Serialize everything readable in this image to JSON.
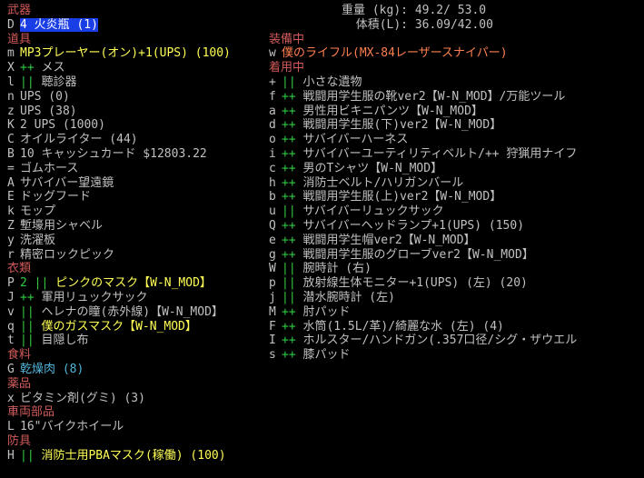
{
  "colors": {
    "category": "#d05a5a",
    "default": "#c0c0c0",
    "white": "#ffffff",
    "yellow": "#ffff55",
    "cyan": "#4fb4d8",
    "green": "#2ecc40",
    "orange": "#ff7f50",
    "highlight_bg": "#1a3ee6"
  },
  "stats": {
    "weight_label": "重量 (kg):",
    "weight_value": "49.2/ 53.0",
    "volume_label": "体積(L):",
    "volume_value": "36.09/42.00"
  },
  "left_rows": [
    {
      "type": "cat",
      "text": "武器"
    },
    {
      "key": "D",
      "mark": "",
      "mark_color": "",
      "text": "4 火炎瓶 (1)",
      "color": "white",
      "highlight": true,
      "tag": ""
    },
    {
      "type": "cat",
      "text": "道具"
    },
    {
      "key": "m",
      "mark": "",
      "mark_color": "",
      "text": "MP3プレーヤー(オン)+1(UPS) (100)",
      "color": "yellow",
      "tag": ""
    },
    {
      "key": "X",
      "mark": "++",
      "mark_color": "green",
      "text": "メス",
      "color": "default",
      "tag": ""
    },
    {
      "key": "l",
      "mark": "||",
      "mark_color": "green",
      "text": "聴診器",
      "color": "default",
      "tag": ""
    },
    {
      "key": "n",
      "mark": "",
      "mark_color": "",
      "text": "UPS (0)",
      "color": "default",
      "tag": ""
    },
    {
      "key": "z",
      "mark": "",
      "mark_color": "",
      "text": "UPS (38)",
      "color": "default",
      "tag": ""
    },
    {
      "key": "K",
      "mark": "",
      "mark_color": "",
      "text": "2 UPS (1000)",
      "color": "default",
      "tag": ""
    },
    {
      "key": "C",
      "mark": "",
      "mark_color": "",
      "text": "オイルライター (44)",
      "color": "default",
      "tag": ""
    },
    {
      "key": "B",
      "mark": "",
      "mark_color": "",
      "text": "10 キャッシュカード  $12803.22",
      "color": "default",
      "tag": ""
    },
    {
      "key": "=",
      "mark": "",
      "mark_color": "",
      "text": "ゴムホース",
      "color": "default",
      "tag": ""
    },
    {
      "key": "A",
      "mark": "",
      "mark_color": "",
      "text": "サバイバー望遠鏡",
      "color": "default",
      "tag": ""
    },
    {
      "key": "E",
      "mark": "",
      "mark_color": "",
      "text": "ドッグフード",
      "color": "default",
      "tag": ""
    },
    {
      "key": "k",
      "mark": "",
      "mark_color": "",
      "text": "モップ",
      "color": "default",
      "tag": ""
    },
    {
      "key": "Z",
      "mark": "",
      "mark_color": "",
      "text": "塹壕用シャベル",
      "color": "default",
      "tag": ""
    },
    {
      "key": "y",
      "mark": "",
      "mark_color": "",
      "text": "洗濯板",
      "color": "default",
      "tag": ""
    },
    {
      "key": "r",
      "mark": "",
      "mark_color": "",
      "text": "精密ロックピック",
      "color": "default",
      "tag": ""
    },
    {
      "type": "cat",
      "text": "衣類"
    },
    {
      "key": "P",
      "mark": "2 ||",
      "mark_color": "green",
      "text": "ピンクのマスク",
      "color": "yellow",
      "tag": "【W-N_MOD】",
      "tag_color": "yellow"
    },
    {
      "key": "J",
      "mark": "++",
      "mark_color": "green",
      "text": "軍用リュックサック",
      "color": "default",
      "tag": ""
    },
    {
      "key": "v",
      "mark": "||",
      "mark_color": "green",
      "text": "ヘレナの瞳(赤外線)",
      "color": "default",
      "tag": "【W-N_MOD】",
      "tag_color": "default"
    },
    {
      "key": "q",
      "mark": "||",
      "mark_color": "green",
      "text": "僕のガスマスク",
      "color": "yellow",
      "tag": "【W-N_MOD】",
      "tag_color": "yellow"
    },
    {
      "key": "t",
      "mark": "||",
      "mark_color": "green",
      "text": "目隠し布",
      "color": "default",
      "tag": ""
    },
    {
      "type": "cat",
      "text": "食料"
    },
    {
      "key": "G",
      "mark": "",
      "mark_color": "",
      "text": "乾燥肉 (8)",
      "color": "cyan",
      "tag": ""
    },
    {
      "type": "cat",
      "text": "薬品"
    },
    {
      "key": "x",
      "mark": "",
      "mark_color": "",
      "text": "ビタミン剤(グミ) (3)",
      "color": "default",
      "tag": ""
    },
    {
      "type": "cat",
      "text": "車両部品"
    },
    {
      "key": "L",
      "mark": "",
      "mark_color": "",
      "text": "16\"バイクホイール",
      "color": "default",
      "tag": ""
    },
    {
      "type": "cat",
      "text": "防具"
    },
    {
      "key": "H",
      "mark": "||",
      "mark_color": "green",
      "text": "消防士用PBAマスク(稼働) (100)",
      "color": "yellow",
      "tag": ""
    }
  ],
  "right_rows": [
    {
      "type": "cat",
      "text": "装備中"
    },
    {
      "key": "w",
      "mark": "",
      "mark_color": "",
      "text": "僕のライフル(MX-84レーザースナイパー)",
      "color": "orange",
      "tag": ""
    },
    {
      "type": "cat",
      "text": "着用中"
    },
    {
      "key": "+",
      "mark": "||",
      "mark_color": "green",
      "text": "小さな遺物",
      "color": "default",
      "tag": ""
    },
    {
      "key": "f",
      "mark": "++",
      "mark_color": "green",
      "text": "戦闘用学生服の靴ver2【W-N_MOD】/万能ツール",
      "color": "default",
      "tag": ""
    },
    {
      "key": "a",
      "mark": "++",
      "mark_color": "green",
      "text": "男性用ビキニパンツ【W-N_MOD】",
      "color": "default",
      "tag": ""
    },
    {
      "key": "d",
      "mark": "++",
      "mark_color": "green",
      "text": "戦闘用学生服(下)ver2【W-N_MOD】",
      "color": "default",
      "tag": ""
    },
    {
      "key": "o",
      "mark": "++",
      "mark_color": "green",
      "text": "サバイバーハーネス",
      "color": "default",
      "tag": ""
    },
    {
      "key": "i",
      "mark": "++",
      "mark_color": "green",
      "text": "サバイバーユーティリティベルト/++ 狩猟用ナイフ",
      "color": "default",
      "tag": ""
    },
    {
      "key": "c",
      "mark": "++",
      "mark_color": "green",
      "text": "男のTシャツ【W-N_MOD】",
      "color": "default",
      "tag": ""
    },
    {
      "key": "h",
      "mark": "++",
      "mark_color": "green",
      "text": "消防士ベルト/ハリガンバール",
      "color": "default",
      "tag": ""
    },
    {
      "key": "b",
      "mark": "++",
      "mark_color": "green",
      "text": "戦闘用学生服(上)ver2【W-N_MOD】",
      "color": "default",
      "tag": ""
    },
    {
      "key": "u",
      "mark": "||",
      "mark_color": "green",
      "text": "サバイバーリュックサック",
      "color": "default",
      "tag": ""
    },
    {
      "key": "Q",
      "mark": "++",
      "mark_color": "green",
      "text": "サバイバーヘッドランプ+1(UPS) (150)",
      "color": "default",
      "tag": ""
    },
    {
      "key": "e",
      "mark": "++",
      "mark_color": "green",
      "text": "戦闘用学生帽ver2【W-N_MOD】",
      "color": "default",
      "tag": ""
    },
    {
      "key": "g",
      "mark": "++",
      "mark_color": "green",
      "text": "戦闘用学生服のグローブver2【W-N_MOD】",
      "color": "default",
      "tag": ""
    },
    {
      "key": "W",
      "mark": "||",
      "mark_color": "green",
      "text": "腕時計 (右)",
      "color": "default",
      "tag": ""
    },
    {
      "key": "p",
      "mark": "||",
      "mark_color": "green",
      "text": "放射線生体モニター+1(UPS) (左) (20)",
      "color": "default",
      "tag": ""
    },
    {
      "key": "j",
      "mark": "||",
      "mark_color": "green",
      "text": "潜水腕時計 (左)",
      "color": "default",
      "tag": ""
    },
    {
      "key": "M",
      "mark": "++",
      "mark_color": "green",
      "text": "肘パッド",
      "color": "default",
      "tag": ""
    },
    {
      "key": "F",
      "mark": "++",
      "mark_color": "green",
      "text": "水筒(1.5L/革)/綺麗な水 (左) (4)",
      "color": "default",
      "tag": ""
    },
    {
      "key": "I",
      "mark": "++",
      "mark_color": "green",
      "text": "ホルスター/ハンドガン(.357口径/シグ・ザウエル",
      "color": "default",
      "tag": ""
    },
    {
      "key": "s",
      "mark": "++",
      "mark_color": "green",
      "text": "膝パッド",
      "color": "default",
      "tag": ""
    }
  ]
}
